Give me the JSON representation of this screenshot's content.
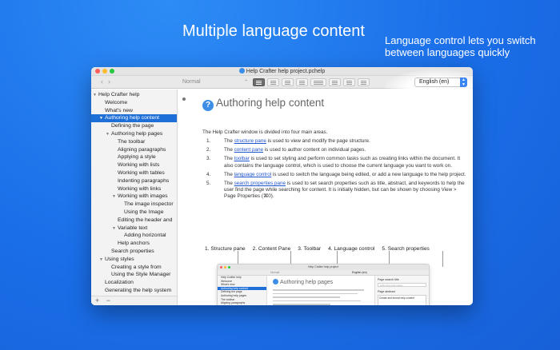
{
  "headline": "Multiple language content",
  "callout": "Language control lets you switch between languages quickly",
  "window": {
    "title": "Help Crafter help project.pchelp",
    "style_select": "Normal",
    "language": "English (en)"
  },
  "sidebar": {
    "items": [
      {
        "label": "Help Crafter help",
        "depth": 0,
        "disclosure": "▼"
      },
      {
        "label": "Welcome",
        "depth": 1,
        "disclosure": ""
      },
      {
        "label": "What's new",
        "depth": 1,
        "disclosure": ""
      },
      {
        "label": "Authoring help content",
        "depth": 1,
        "disclosure": "▼",
        "selected": true
      },
      {
        "label": "Defining the page",
        "depth": 2,
        "disclosure": ""
      },
      {
        "label": "Authoring help pages",
        "depth": 2,
        "disclosure": "▼"
      },
      {
        "label": "The toolbar",
        "depth": 3,
        "disclosure": ""
      },
      {
        "label": "Aligning paragraphs",
        "depth": 3,
        "disclosure": ""
      },
      {
        "label": "Applying a style",
        "depth": 3,
        "disclosure": ""
      },
      {
        "label": "Working with lists",
        "depth": 3,
        "disclosure": ""
      },
      {
        "label": "Working with tables",
        "depth": 3,
        "disclosure": ""
      },
      {
        "label": "Indenting paragraphs",
        "depth": 3,
        "disclosure": ""
      },
      {
        "label": "Working with links",
        "depth": 3,
        "disclosure": ""
      },
      {
        "label": "Working with images",
        "depth": 3,
        "disclosure": "▼"
      },
      {
        "label": "The image inspector",
        "depth": 4,
        "disclosure": ""
      },
      {
        "label": "Using the Image",
        "depth": 4,
        "disclosure": ""
      },
      {
        "label": "Editing the header and",
        "depth": 3,
        "disclosure": ""
      },
      {
        "label": "Variable text",
        "depth": 3,
        "disclosure": "▼"
      },
      {
        "label": "Adding horizontal",
        "depth": 4,
        "disclosure": ""
      },
      {
        "label": "Help anchors",
        "depth": 3,
        "disclosure": ""
      },
      {
        "label": "Search properties",
        "depth": 2,
        "disclosure": ""
      },
      {
        "label": "Using styles",
        "depth": 1,
        "disclosure": "▼"
      },
      {
        "label": "Creating a style from",
        "depth": 2,
        "disclosure": ""
      },
      {
        "label": "Using the Style Manager",
        "depth": 2,
        "disclosure": ""
      },
      {
        "label": "Localization",
        "depth": 1,
        "disclosure": ""
      },
      {
        "label": "Generating the help system",
        "depth": 1,
        "disclosure": ""
      }
    ],
    "add_label": "+",
    "remove_label": "−"
  },
  "content": {
    "title": "Authoring help content",
    "intro": "The Help Crafter window is divided into four main areas.",
    "steps": [
      {
        "num": "1.",
        "pre": "The ",
        "link": "structure pane",
        "post": " is used to view and modify the page structure."
      },
      {
        "num": "2.",
        "pre": "The ",
        "link": "content pane",
        "post": " is used to author content on individual pages."
      },
      {
        "num": "3.",
        "pre": "The ",
        "link": "toolbar",
        "post": " is used to set styling and perform common tasks such as creating links within the document. It also contains the language control, which is used to choose the current language you want to work on."
      },
      {
        "num": "4.",
        "pre": "The ",
        "link": "language control",
        "post": " is used to switch the language being edited, or add a new language to the help project."
      },
      {
        "num": "5.",
        "pre": "The ",
        "link": "search properties pane",
        "post": " is used to set search properties such as title, abstract, and keywords to help the user find the page while searching for content. It is initially hidden, but can be shown by choosing View > Page Properties (⌘0)."
      }
    ],
    "labels": [
      "1. Structure pane",
      "2. Content Pane",
      "3. Toolbar",
      "4. Language control",
      "5. Search properties"
    ]
  },
  "mini": {
    "title": "Help Crafter help project",
    "heading": "Authoring help pages",
    "language": "English (en)",
    "style": "Normal",
    "sidebar": [
      "Help Crafter help",
      "Welcome",
      "What's new",
      "Authoring help content",
      "Defining the page",
      "Authoring help pages",
      "The toolbar",
      "Aligning paragraphs",
      "Applying a style",
      "Working with lists",
      "Working with tables",
      "Indenting paragraphs",
      "Working with links"
    ],
    "search_title_label": "Page search title",
    "search_title_placeholder": "Authoring help pages",
    "abstract_label": "Page abstract",
    "abstract_text": "Create and format help content"
  },
  "colors": {
    "accent": "#1f6fd8",
    "link": "#1f55d0",
    "background": "#1a6ee8"
  }
}
